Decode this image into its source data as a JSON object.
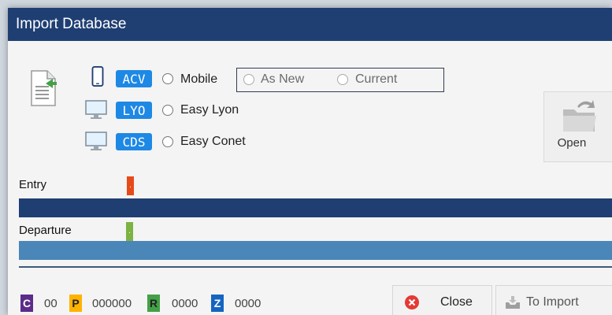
{
  "window": {
    "title": "Import Database"
  },
  "sources": [
    {
      "code": "ACV",
      "label": "Mobile",
      "device": "phone-icon"
    },
    {
      "code": "LYO",
      "label": "Easy Lyon",
      "device": "monitor-icon"
    },
    {
      "code": "CDS",
      "label": "Easy Conet",
      "device": "monitor-icon"
    }
  ],
  "mode": {
    "options": [
      "As New",
      "Current"
    ]
  },
  "open_button": {
    "label": "Open",
    "icon": "folder-open-icon"
  },
  "progress": {
    "entry": {
      "label": "Entry",
      "marker_color": "#e64a19",
      "bar_color": "#1f3f73"
    },
    "departure": {
      "label": "Departure",
      "marker_color": "#7cb342",
      "bar_color": "#4a86b8"
    }
  },
  "counters": [
    {
      "letter": "C",
      "value": "00",
      "color": "#5b2c8a"
    },
    {
      "letter": "P",
      "value": "000000",
      "color": "#ffb300"
    },
    {
      "letter": "R",
      "value": "0000",
      "color": "#43a047"
    },
    {
      "letter": "Z",
      "value": "0000",
      "color": "#1565c0"
    }
  ],
  "buttons": {
    "close": {
      "label": "Close",
      "icon": "close-circle-icon"
    },
    "import": {
      "label": "To Import",
      "icon": "import-tray-icon"
    }
  }
}
